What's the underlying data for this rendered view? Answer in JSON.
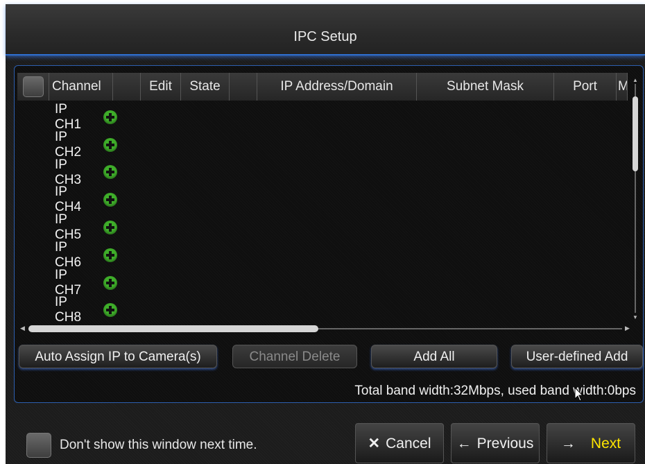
{
  "window": {
    "title": "IPC Setup"
  },
  "table": {
    "columns": [
      "Channel",
      "",
      "Edit",
      "State",
      "",
      "IP Address/Domain",
      "Subnet Mask",
      "Port",
      "M"
    ],
    "rows": [
      "IP CH1",
      "IP CH2",
      "IP CH3",
      "IP CH4",
      "IP CH5",
      "IP CH6",
      "IP CH7",
      "IP CH8"
    ]
  },
  "actions": {
    "auto_assign": "Auto Assign IP to Camera(s)",
    "channel_delete": "Channel Delete",
    "add_all": "Add All",
    "user_defined_add": "User-defined Add"
  },
  "bandwidth": "Total band width:32Mbps, used band width:0bps",
  "footer": {
    "dont_show": "Don't show this window next time.",
    "cancel": "Cancel",
    "previous": "Previous",
    "next": "Next"
  },
  "icons": {
    "add_channel": "plus-circle-icon",
    "cancel": "x-icon",
    "previous": "arrow-left-icon",
    "next": "arrow-right-icon"
  },
  "colors": {
    "accent": "#2f6fd0",
    "add_icon": "#3fae2a",
    "next_label": "#ffe600"
  }
}
